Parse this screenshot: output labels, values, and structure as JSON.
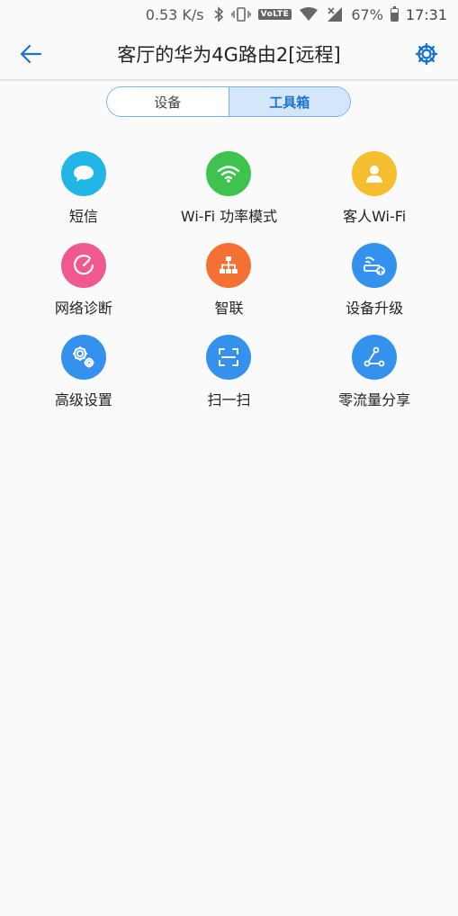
{
  "status_bar": {
    "net_speed": "0.53 K/s",
    "volte_label": "VoLTE",
    "battery": "67%",
    "battery_level": 0.67,
    "time": "17:31"
  },
  "header": {
    "title": "客厅的华为4G路由2[远程]",
    "back_icon": "arrow-left-icon",
    "settings_icon": "gear-icon"
  },
  "tabs": {
    "device": "设备",
    "toolbox": "工具箱",
    "active": "toolbox"
  },
  "tools": [
    {
      "label": "短信",
      "icon": "chat-bubble-icon",
      "color": "#21b6e6"
    },
    {
      "label": "Wi-Fi 功率模式",
      "icon": "wifi-icon",
      "color": "#3ec44e"
    },
    {
      "label": "客人Wi-Fi",
      "icon": "person-icon",
      "color": "#f6be2f"
    },
    {
      "label": "网络诊断",
      "icon": "gauge-icon",
      "color": "#ef5990"
    },
    {
      "label": "智联",
      "icon": "network-tree-icon",
      "color": "#f47034"
    },
    {
      "label": "设备升级",
      "icon": "router-upgrade-icon",
      "color": "#3492ee"
    },
    {
      "label": "高级设置",
      "icon": "gears-icon",
      "color": "#3492ee"
    },
    {
      "label": "扫一扫",
      "icon": "scan-icon",
      "color": "#3492ee"
    },
    {
      "label": "零流量分享",
      "icon": "share-icon",
      "color": "#3492ee"
    }
  ],
  "colors": {
    "accent": "#1a73d0",
    "tab_active_bg": "#d4e6fa"
  }
}
